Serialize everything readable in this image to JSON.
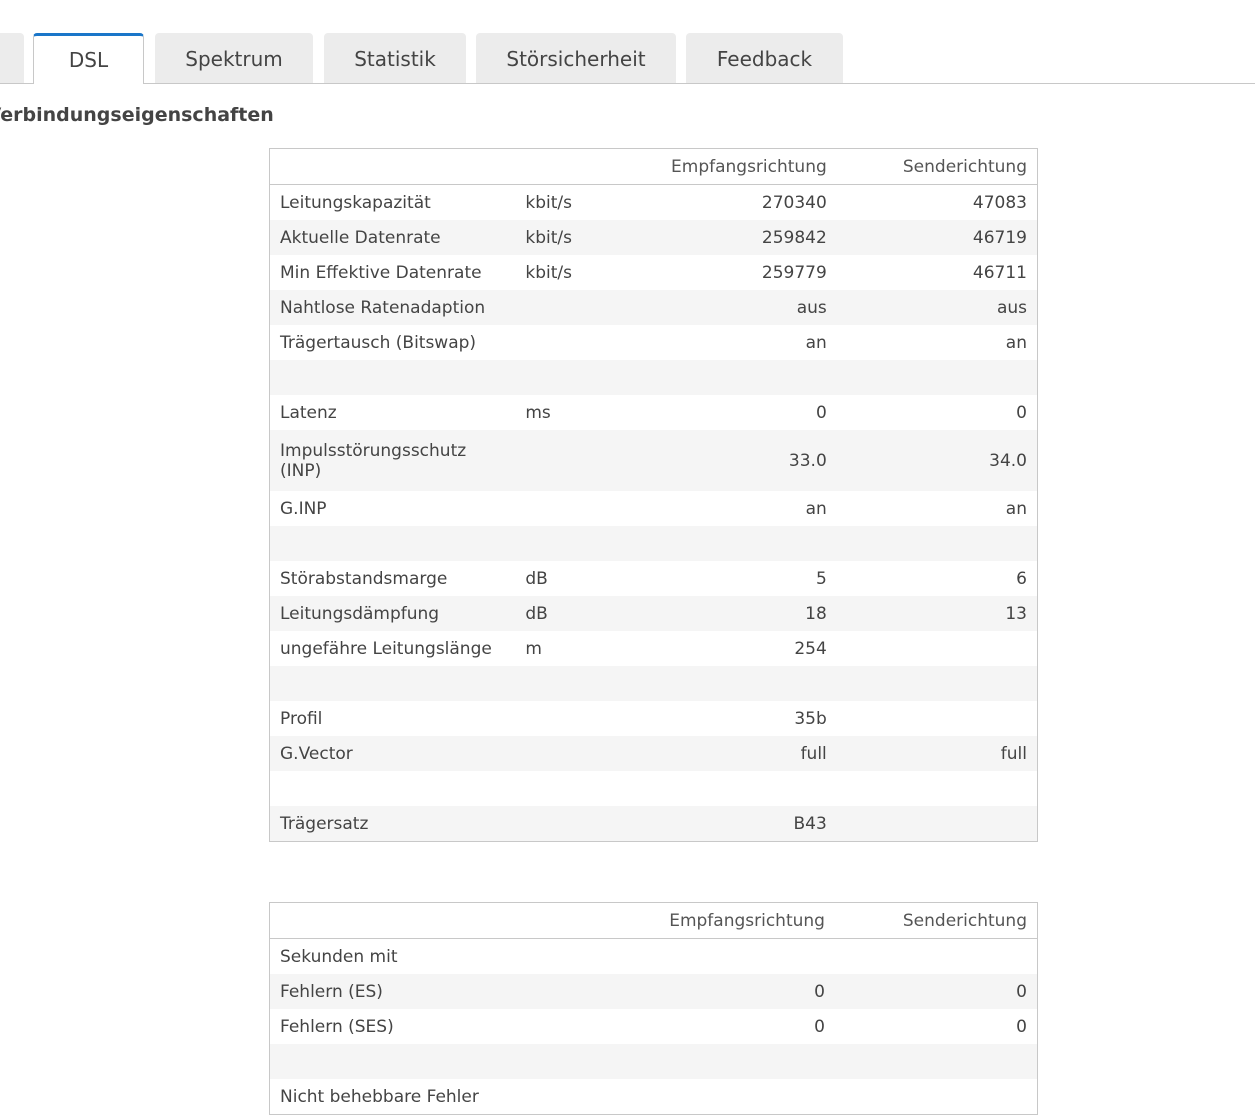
{
  "tabs": [
    {
      "label": "",
      "active": false
    },
    {
      "label": "DSL",
      "active": true
    },
    {
      "label": "Spektrum",
      "active": false
    },
    {
      "label": "Statistik",
      "active": false
    },
    {
      "label": "Störsicherheit",
      "active": false
    },
    {
      "label": "Feedback",
      "active": false
    }
  ],
  "section_title": "te Verbindungseigenschaften",
  "colors": {
    "accent": "#1a76c9",
    "row_alt": "#f5f5f5",
    "border": "#c8c8c8"
  },
  "table1": {
    "headers": [
      "",
      "",
      "Empfangsrichtung",
      "Senderichtung"
    ],
    "rows": [
      [
        "Leitungskapazität",
        "kbit/s",
        "270340",
        "47083"
      ],
      [
        "Aktuelle Datenrate",
        "kbit/s",
        "259842",
        "46719"
      ],
      [
        "Min Effektive Datenrate",
        "kbit/s",
        "259779",
        "46711"
      ],
      [
        "Nahtlose Ratenadaption",
        "",
        "aus",
        "aus"
      ],
      [
        "Trägertausch (Bitswap)",
        "",
        "an",
        "an"
      ],
      [
        "",
        "",
        "",
        ""
      ],
      [
        "Latenz",
        "ms",
        "0",
        "0"
      ],
      [
        "Impulsstörungsschutz (INP)",
        "",
        "33.0",
        "34.0"
      ],
      [
        "G.INP",
        "",
        "an",
        "an"
      ],
      [
        "",
        "",
        "",
        ""
      ],
      [
        "Störabstandsmarge",
        "dB",
        "5",
        "6"
      ],
      [
        "Leitungsdämpfung",
        "dB",
        "18",
        "13"
      ],
      [
        "ungefähre Leitungslänge",
        "m",
        "254",
        ""
      ],
      [
        "",
        "",
        "",
        ""
      ],
      [
        "Profil",
        "",
        "35b",
        ""
      ],
      [
        "G.Vector",
        "",
        "full",
        "full"
      ],
      [
        "",
        "",
        "",
        ""
      ],
      [
        "Trägersatz",
        "",
        "B43",
        ""
      ]
    ]
  },
  "table2": {
    "headers": [
      "",
      "",
      "Empfangsrichtung",
      "Senderichtung"
    ],
    "rows": [
      [
        "Sekunden mit",
        "",
        "",
        ""
      ],
      [
        "Fehlern (ES)",
        "",
        "0",
        "0"
      ],
      [
        "Fehlern (SES)",
        "",
        "0",
        "0"
      ],
      [
        "",
        "",
        "",
        ""
      ],
      [
        "Nicht behebbare Fehler",
        "",
        "",
        ""
      ]
    ]
  }
}
